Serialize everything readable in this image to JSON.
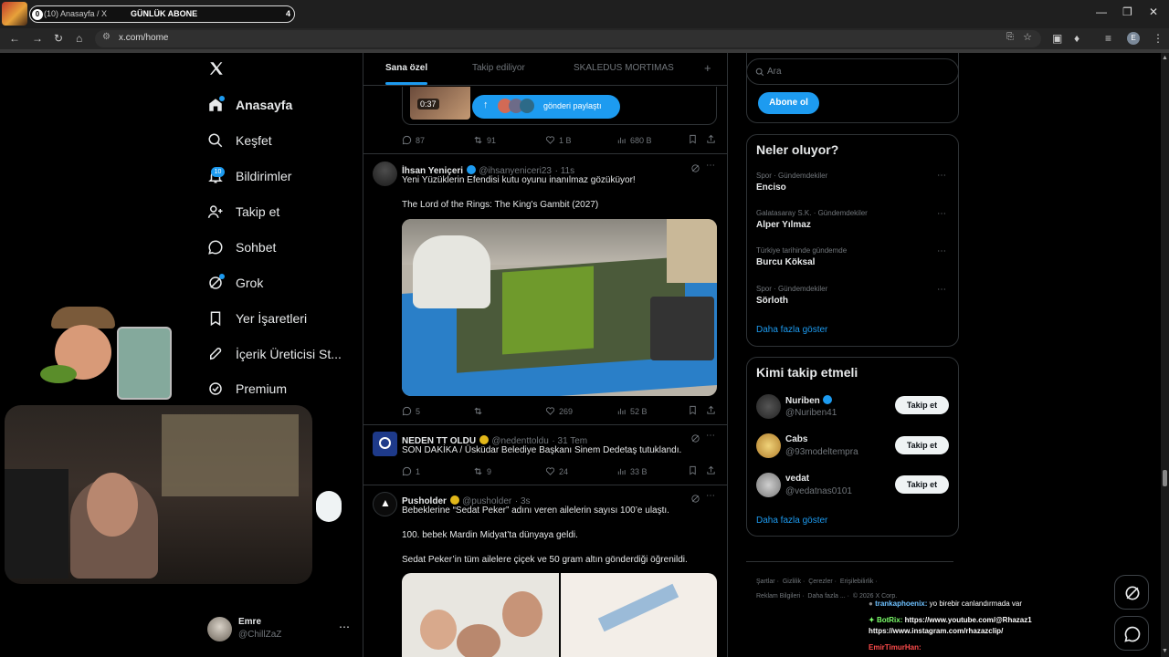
{
  "browser": {
    "tab_title": "(10) Anasayfa / X",
    "tab_overlay_label": "GÜNLÜK ABONE",
    "tab_overlay_count": "4",
    "tab_badge": "0",
    "url": "x.com/home",
    "profile_initial": "E"
  },
  "nav": {
    "items": [
      {
        "label": "Anasayfa",
        "icon": "home-icon"
      },
      {
        "label": "Keşfet",
        "icon": "search-icon"
      },
      {
        "label": "Bildirimler",
        "icon": "bell-icon"
      },
      {
        "label": "Takip et",
        "icon": "follow-icon"
      },
      {
        "label": "Sohbet",
        "icon": "chat-icon"
      },
      {
        "label": "Grok",
        "icon": "grok-icon"
      },
      {
        "label": "Yer İşaretleri",
        "icon": "bookmark-icon"
      },
      {
        "label": "İçerik Üreticisi St...",
        "icon": "rocket-icon"
      },
      {
        "label": "Premium",
        "icon": "premium-icon"
      }
    ],
    "notif_count": "10",
    "account": {
      "name": "Emre",
      "handle": "@ChillZaZ"
    }
  },
  "feed_tabs": [
    "Sana özel",
    "Takip ediliyor",
    "SKALEDUS MORTIMAS"
  ],
  "prev_tweet": {
    "video_time": "0:37",
    "share_label": "gönderi paylaştı",
    "replies": "87",
    "reposts": "91",
    "likes": "1 B",
    "views": "680 B"
  },
  "tweets": [
    {
      "name": "İhsan Yeniçeri",
      "handle": "@ihsanyeniceri23",
      "time": "· 11s",
      "lines": [
        "Yeni Yüzüklerin Efendisi kutu oyunu inanılmaz gözüküyor!",
        "The Lord of the Rings: The King's Gambit (2027)"
      ],
      "replies": "5",
      "reposts": "",
      "likes": "269",
      "views": "52 B"
    },
    {
      "name": "NEDEN TT OLDU",
      "handle": "@nedenttoldu",
      "time": "· 31 Tem",
      "lines": [
        "SON DAKİKA / Üsküdar Belediye Başkanı Sinem Dedetaş tutuklandı."
      ],
      "replies": "1",
      "reposts": "9",
      "likes": "24",
      "views": "33 B"
    },
    {
      "name": "Pusholder",
      "handle": "@pusholder",
      "time": "· 3s",
      "lines": [
        "Bebeklerine “Sedat Peker” adını veren ailelerin sayısı 100’e ulaştı.",
        "100. bebek Mardin Midyat’ta dünyaya geldi.",
        "Sedat Peker’in tüm ailelere çiçek ve 50 gram altın gönderdiği öğrenildi."
      ]
    }
  ],
  "right": {
    "subscribe_label": "Abone ol",
    "search_placeholder": "Ara",
    "trends_title": "Neler oluyor?",
    "trends": [
      {
        "meta": "Spor · Gündemdekiler",
        "name": "Enciso"
      },
      {
        "meta": "Galatasaray S.K. · Gündemdekiler",
        "name": "Alper Yılmaz"
      },
      {
        "meta": "Türkiye tarihinde gündemde",
        "name": "Burcu Köksal"
      },
      {
        "meta": "Spor · Gündemdekiler",
        "name": "Sörloth"
      }
    ],
    "show_more": "Daha fazla göster",
    "who_title": "Kimi takip etmeli",
    "who": [
      {
        "name": "Nuriben",
        "handle": "@Nuriben41",
        "verified": true
      },
      {
        "name": "Cabs",
        "handle": "@93modeltempra",
        "verified": false
      },
      {
        "name": "vedat",
        "handle": "@vedatnas0101",
        "verified": false
      }
    ],
    "follow_label": "Takip et",
    "footer": [
      "Şartlar",
      "·",
      "Gizlilik",
      "·",
      "Çerezler",
      "·",
      "Erişilebilirlik",
      "·",
      "Reklam Bilgileri",
      "·",
      "Daha fazla ...",
      "·",
      "© 2026 X Corp."
    ]
  },
  "stream_chat": [
    {
      "user": "trankaphoenix:",
      "text": "yo birebir canlandırmada var",
      "color": "#6ec1ff"
    },
    {
      "user": "BotRix:",
      "text": "https://www.youtube.com/@Rhazaz1",
      "color": "#7cff6b"
    },
    {
      "user": "",
      "text": "https://www.instagram.com/rhazazclip/",
      "color": "#ffffff"
    },
    {
      "user": "EmirTimurHan:",
      "text": "",
      "color": "#ff4b4b"
    }
  ],
  "colors": {
    "accent": "#1d9bf0",
    "bg": "#000000",
    "border": "#2f3336",
    "muted": "#71767b"
  }
}
